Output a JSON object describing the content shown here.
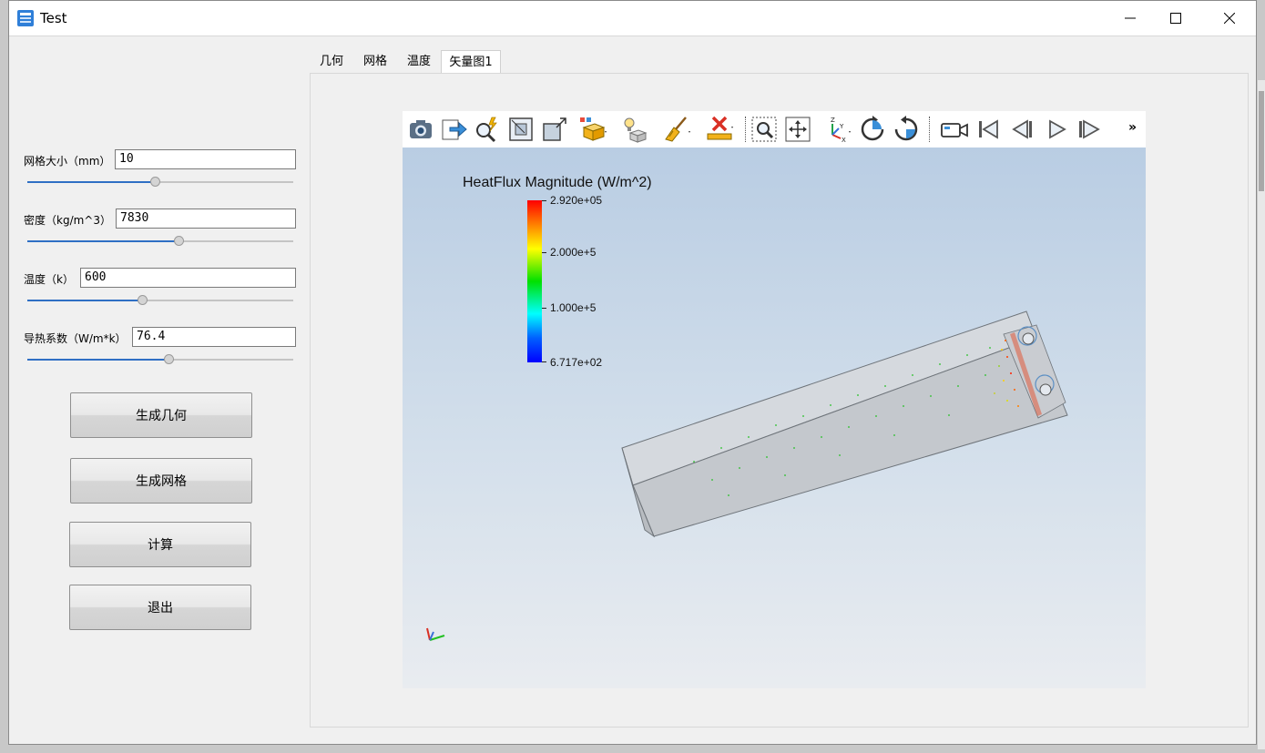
{
  "window": {
    "title": "Test"
  },
  "controls": {
    "fields": [
      {
        "label": "网格大小（mm）",
        "value": "10",
        "slider": 0.48
      },
      {
        "label": "密度（kg/m^3）",
        "value": "7830",
        "slider": 0.57
      },
      {
        "label": "温度（k）",
        "value": "600",
        "slider": 0.43
      },
      {
        "label": "导热系数（W/m*k）",
        "value": "76.4",
        "slider": 0.53
      }
    ],
    "buttons": [
      {
        "label": "生成几何"
      },
      {
        "label": "生成网格"
      },
      {
        "label": "计算"
      },
      {
        "label": "退出"
      }
    ]
  },
  "tabs": [
    {
      "label": "几何"
    },
    {
      "label": "网格"
    },
    {
      "label": "温度"
    },
    {
      "label": "矢量图1",
      "active": true
    }
  ],
  "viewer": {
    "toolbar_icons": [
      "camera-icon",
      "export-icon",
      "zoom-magic-icon",
      "zoom-box-icon",
      "resize-icon",
      "box-select-icon",
      "light-icon",
      "clear-icon",
      "remove-icon",
      "zoom-selection-icon",
      "fit-view-icon",
      "axes-orientation-icon",
      "rotate-cw-icon",
      "rotate-ccw-icon",
      "camera-video-icon",
      "first-frame-icon",
      "previous-frame-icon",
      "play-icon",
      "next-frame-icon"
    ],
    "overflow_label": "»",
    "legend": {
      "title": "HeatFlux Magnitude (W/m^2)",
      "max": "2.920e+05",
      "mid_high": "2.000e+5",
      "mid_low": "1.000e+5",
      "min": "6.717e+02",
      "colors": [
        "#ff0000",
        "#ff8000",
        "#ffff00",
        "#00e000",
        "#00ffff",
        "#0060ff",
        "#0000ff"
      ]
    }
  }
}
